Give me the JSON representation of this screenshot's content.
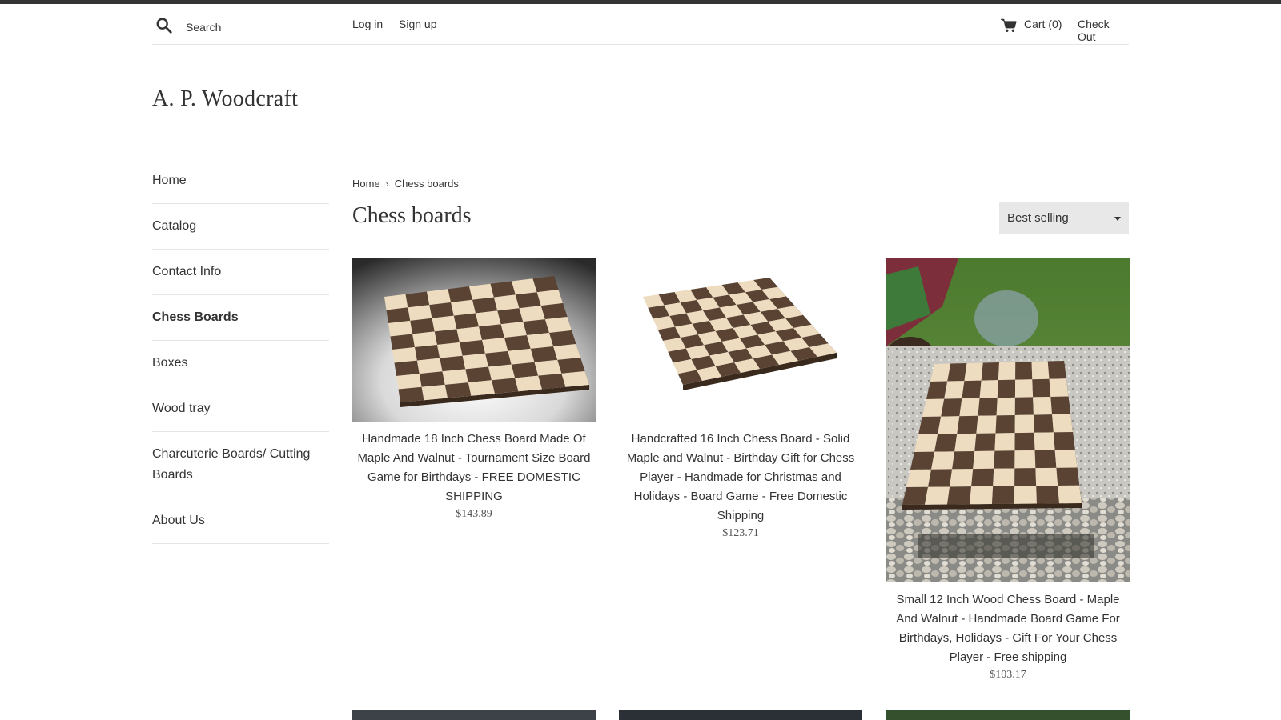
{
  "header": {
    "search_placeholder": "Search",
    "login": "Log in",
    "signup": "Sign up",
    "cart": "Cart (0)",
    "checkout": "Check Out"
  },
  "store": {
    "name": "A. P. Woodcraft"
  },
  "sidebar": {
    "items": [
      {
        "label": "Home"
      },
      {
        "label": "Catalog"
      },
      {
        "label": "Contact Info"
      },
      {
        "label": "Chess Boards",
        "active": true
      },
      {
        "label": "Boxes"
      },
      {
        "label": "Wood tray"
      },
      {
        "label": "Charcuterie Boards/ Cutting Boards"
      },
      {
        "label": "About Us"
      }
    ]
  },
  "breadcrumb": {
    "home": "Home",
    "separator": "›",
    "current": "Chess boards"
  },
  "collection": {
    "title": "Chess boards"
  },
  "sort": {
    "selected": "Best selling"
  },
  "products": [
    {
      "title": "Handmade 18 Inch Chess Board Made Of Maple And Walnut - Tournament Size Board Game for Birthdays - FREE DOMESTIC SHIPPING",
      "price": "$143.89"
    },
    {
      "title": "Handcrafted 16 Inch Chess Board - Solid Maple and Walnut - Birthday Gift for Chess Player - Handmade for Christmas and Holidays - Board Game - Free Domestic Shipping",
      "price": "$123.71"
    },
    {
      "title": "Small 12 Inch Wood Chess Board - Maple And Walnut - Handmade Board Game For Birthdays, Holidays - Gift For Your Chess Player - Free shipping",
      "price": "$103.17"
    }
  ],
  "colors": {
    "text": "#333333",
    "border": "#e5e5e5",
    "maple": "#eedcc0",
    "walnut": "#5a4332",
    "select_bg": "#e8e8e8"
  }
}
